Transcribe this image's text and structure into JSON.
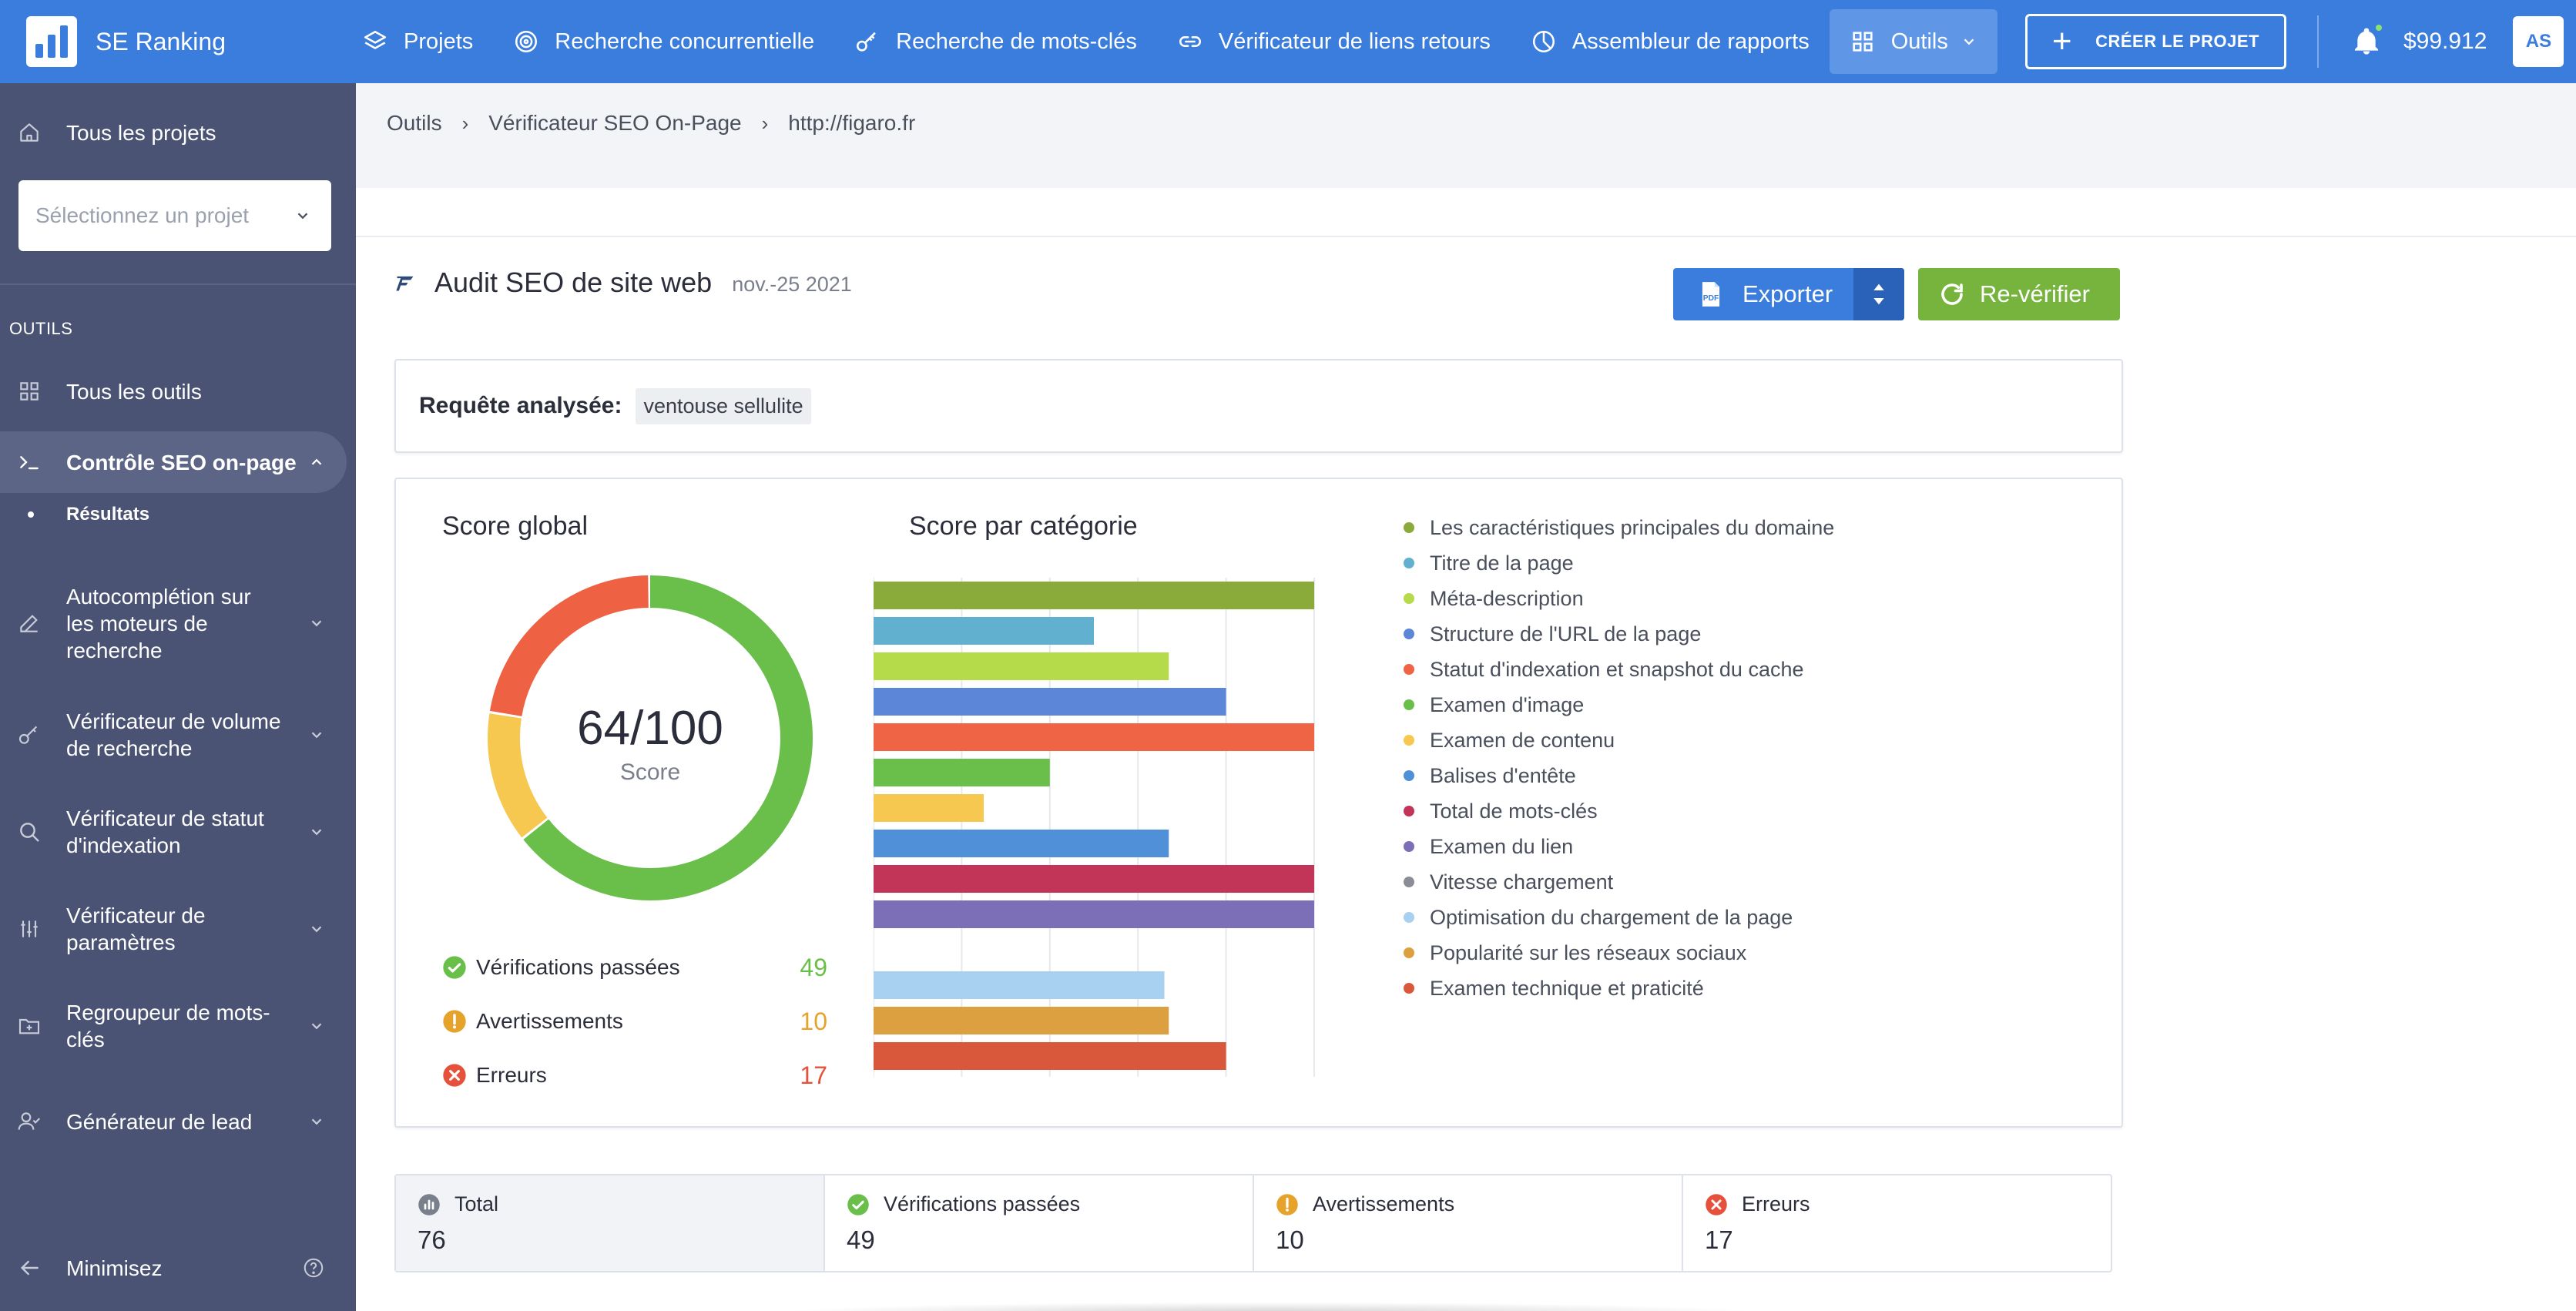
{
  "topbar": {
    "brand": "SE Ranking",
    "nav": [
      {
        "label": "Projets",
        "icon": "layers-icon"
      },
      {
        "label": "Recherche concurrentielle",
        "icon": "target-icon"
      },
      {
        "label": "Recherche de mots-clés",
        "icon": "key-icon"
      },
      {
        "label": "Vérificateur de liens retours",
        "icon": "link-icon"
      },
      {
        "label": "Assembleur de rapports",
        "icon": "pie-chart-icon"
      },
      {
        "label": "Outils",
        "icon": "grid-icon",
        "active": true
      }
    ],
    "create_button": "CRÉER LE PROJET",
    "balance": "$99.912",
    "avatar": "AS"
  },
  "sidebar": {
    "all_projects": "Tous les projets",
    "project_select_placeholder": "Sélectionnez un projet",
    "section_label": "OUTILS",
    "items": [
      {
        "label": "Tous les outils",
        "icon": "grid-icon"
      },
      {
        "label": "Contrôle SEO on-page",
        "icon": "terminal-icon",
        "active": true
      },
      {
        "label": "Autocomplétion sur les moteurs de recherche",
        "icon": "pencil-icon"
      },
      {
        "label": "Vérificateur de volume de recherche",
        "icon": "key-icon"
      },
      {
        "label": "Vérificateur de statut d'indexation",
        "icon": "search-icon"
      },
      {
        "label": "Vérificateur de paramètres",
        "icon": "sliders-icon"
      },
      {
        "label": "Regroupeur de mots-clés",
        "icon": "folder-plus-icon"
      },
      {
        "label": "Générateur de lead",
        "icon": "user-check-icon"
      }
    ],
    "sub_item": "Résultats",
    "minimize": "Minimisez"
  },
  "breadcrumb": [
    "Outils",
    "Vérificateur SEO On-Page",
    "http://figaro.fr"
  ],
  "page": {
    "title": "Audit SEO de site web",
    "date": "nov.-25 2021",
    "export_label": "Exporter",
    "recheck_label": "Re-vérifier",
    "query_label": "Requête analysée:",
    "query_value": "ventouse sellulite"
  },
  "score": {
    "global_title": "Score global",
    "value": "64/100",
    "caption": "Score",
    "category_title": "Score par catégorie",
    "stats": [
      {
        "label": "Vérifications passées",
        "value": "49",
        "color": "#6abf4b"
      },
      {
        "label": "Avertissements",
        "value": "10",
        "color": "#e5a32b"
      },
      {
        "label": "Erreurs",
        "value": "17",
        "color": "#e5513b"
      }
    ]
  },
  "chart_data": [
    {
      "type": "pie",
      "categories": [
        "Vérifications passées",
        "Avertissements",
        "Erreurs"
      ],
      "values": [
        49,
        10,
        17
      ],
      "colors": [
        "#6abf4b",
        "#f7c850",
        "#ef6143"
      ]
    },
    {
      "type": "bar",
      "orientation": "horizontal",
      "categories": [
        "Les caractéristiques principales du domaine",
        "Titre de la page",
        "Méta-description",
        "Structure de l'URL de la page",
        "Statut d'indexation et snapshot du cache",
        "Examen d'image",
        "Examen de contenu",
        "Balises d'entête",
        "Total de mots-clés",
        "Examen du lien",
        "Vitesse chargement",
        "Optimisation du chargement de la page",
        "Popularité sur les réseaux sociaux",
        "Examen technique et praticité"
      ],
      "values": [
        100,
        50,
        67,
        80,
        100,
        40,
        25,
        67,
        100,
        100,
        0,
        66,
        67,
        80
      ],
      "colors": [
        "#8aaa3a",
        "#62b0d0",
        "#b5da4a",
        "#5c86d8",
        "#f06446",
        "#6abf4b",
        "#f7c850",
        "#4f90d8",
        "#c23558",
        "#7c6fb8",
        "#8a8d96",
        "#a8d0f0",
        "#dda040",
        "#d9573a"
      ],
      "xlim": [
        0,
        100
      ],
      "xticks": [
        "0%",
        "20%",
        "40%",
        "60%",
        "80%",
        "100%"
      ],
      "grid": true,
      "legend": "right"
    }
  ],
  "summary": [
    {
      "label": "Total",
      "value": "76",
      "icon": "bar-chart-icon"
    },
    {
      "label": "Vérifications passées",
      "value": "49",
      "icon": "check-circle-icon"
    },
    {
      "label": "Avertissements",
      "value": "10",
      "icon": "warning-circle-icon"
    },
    {
      "label": "Erreurs",
      "value": "17",
      "icon": "error-circle-icon"
    }
  ]
}
